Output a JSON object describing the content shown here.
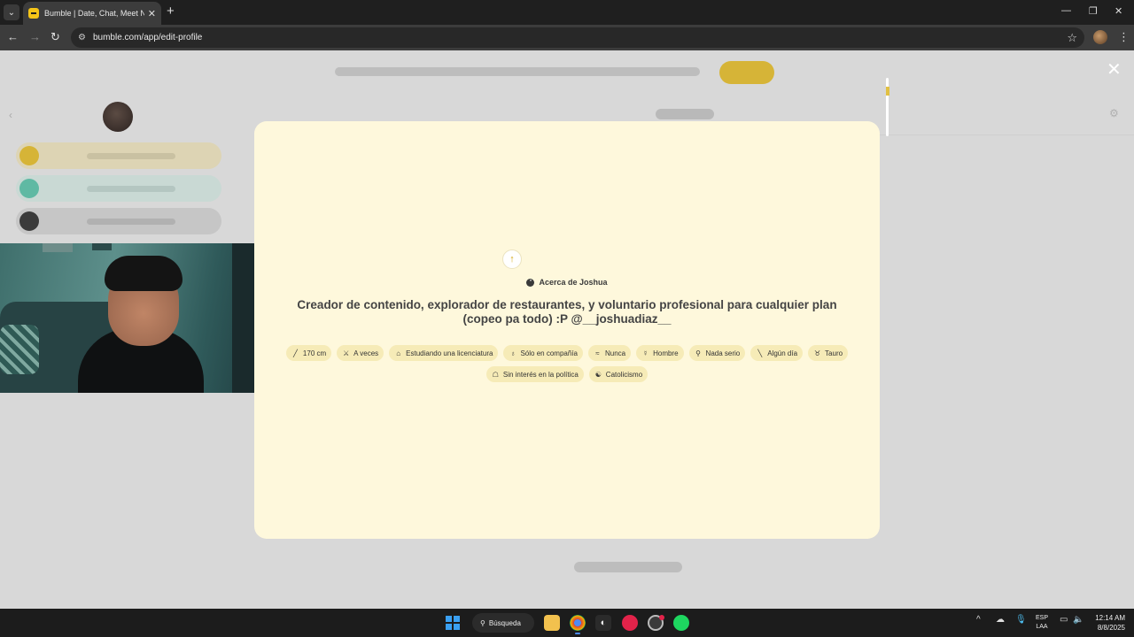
{
  "browser": {
    "tab_title": "Bumble | Date, Chat, Meet New",
    "url": "bumble.com/app/edit-profile"
  },
  "modal": {
    "about_label": "Acerca de Joshua",
    "bio": "Creador de contenido, explorador de restaurantes, y voluntario profesional para cualquier plan (copeo pa todo) :P @__joshuadiaz__",
    "chips": [
      {
        "icon": "ruler-icon",
        "glyph": "╱",
        "label": "170 cm"
      },
      {
        "icon": "dumbbell-icon",
        "glyph": "⚔",
        "label": "A veces"
      },
      {
        "icon": "graduation-cap-icon",
        "glyph": "⌂",
        "label": "Estudiando una licenciatura"
      },
      {
        "icon": "wine-glass-icon",
        "glyph": "♁",
        "label": "Sólo en compañía"
      },
      {
        "icon": "smoking-icon",
        "glyph": "≈",
        "label": "Nunca"
      },
      {
        "icon": "gender-icon",
        "glyph": "☿",
        "label": "Hombre"
      },
      {
        "icon": "magnifier-icon",
        "glyph": "⚲",
        "label": "Nada serio"
      },
      {
        "icon": "baby-bottle-icon",
        "glyph": "╲",
        "label": "Algún día"
      },
      {
        "icon": "zodiac-icon",
        "glyph": "♉",
        "label": "Tauro"
      },
      {
        "icon": "bank-icon",
        "glyph": "☖",
        "label": "Sin interés en la política"
      },
      {
        "icon": "religion-icon",
        "glyph": "☯",
        "label": "Catolicismo"
      }
    ]
  },
  "taskbar": {
    "search_label": "Búsqueda",
    "lang_line1": "ESP",
    "lang_line2": "LAA",
    "time": "12:14 AM",
    "date": "8/8/2025"
  },
  "colors": {
    "modal_bg": "#fef8dc",
    "chip_bg": "#f6ebb7",
    "brand_yellow": "#f5c518"
  }
}
